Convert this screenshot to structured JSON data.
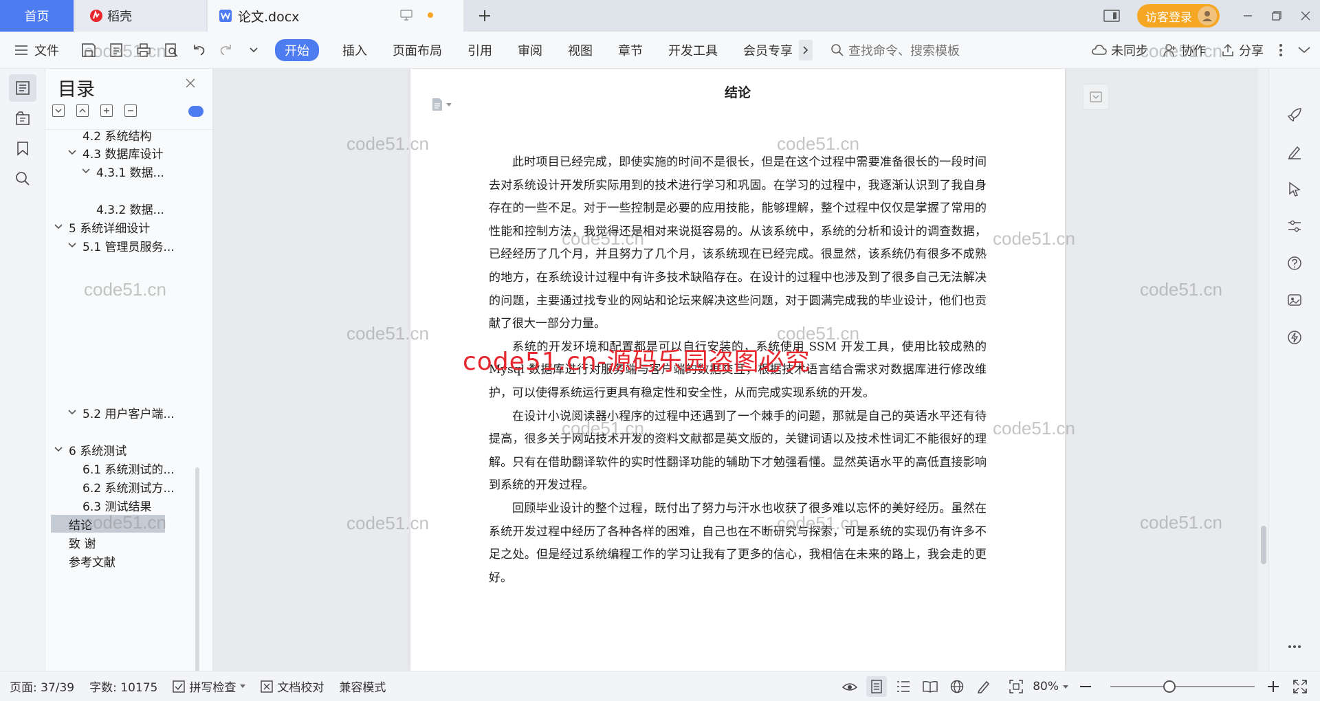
{
  "tabs": {
    "home": "首页",
    "daoke": "稻壳",
    "doc": "论文.docx"
  },
  "titlebar": {
    "login": "访客登录"
  },
  "menubar": {
    "file": "文件",
    "items": [
      "开始",
      "插入",
      "页面布局",
      "引用",
      "审阅",
      "视图",
      "章节",
      "开发工具",
      "会员专享"
    ],
    "active_index": 0,
    "search_placeholder": "查找命令、搜索模板",
    "sync": "未同步",
    "collab": "协作",
    "share": "分享"
  },
  "toc": {
    "title": "目录",
    "items": [
      {
        "label": "4.2  系统结构",
        "level": 2,
        "chevron": false
      },
      {
        "label": "4.3 数据库设计",
        "level": 2,
        "chevron": true
      },
      {
        "label": "4.3.1  数据...",
        "level": 3,
        "chevron": true
      },
      {
        "label": "4.3.2  数据...",
        "level": 3,
        "chevron": false
      },
      {
        "label": "5  系统详细设计",
        "level": 1,
        "chevron": true
      },
      {
        "label": "5.1 管理员服务...",
        "level": 2,
        "chevron": true
      },
      {
        "label": "5.2 用户客户端...",
        "level": 2,
        "chevron": true
      },
      {
        "label": "6  系统测试",
        "level": 1,
        "chevron": true
      },
      {
        "label": "6.1 系统测试的...",
        "level": 2,
        "chevron": false
      },
      {
        "label": "6.2 系统测试方...",
        "level": 2,
        "chevron": false
      },
      {
        "label": "6.3  测试结果",
        "level": 2,
        "chevron": false
      },
      {
        "label": "结论",
        "level": 1,
        "chevron": false,
        "selected": true
      },
      {
        "label": "致    谢",
        "level": 1,
        "chevron": false
      },
      {
        "label": "参考文献",
        "level": 1,
        "chevron": false
      }
    ]
  },
  "document": {
    "title": "结论",
    "paragraphs": [
      "此时项目已经完成，即使实施的时间不是很长，但是在这个过程中需要准备很长的一段时间去对系统设计开发所实际用到的技术进行学习和巩固。在学习的过程中，我逐渐认识到了我自身存在的一些不足。对于一些控制是必要的应用技能，能够理解，整个过程中仅仅是掌握了常用的性能和控制方法，我觉得还是相对来说挺容易的。从该系统中，系统的分析和设计的调查数据，已经经历了几个月，并且努力了几个月，该系统现在已经完成。很显然，该系统仍有很多不成熟的地方，在系统设计过程中有许多技术缺陷存在。在设计的过程中也涉及到了很多自己无法解决的问题，主要通过找专业的网站和论坛来解决这些问题，对于圆满完成我的毕业设计，他们也贡献了很大一部分力量。",
      "系统的开发环境和配置都是可以自行安装的，系统使用 SSM 开发工具，使用比较成熟的 Mysql 数据库进行对服务端与客户端的数据交互，根据技术语言结合需求对数据库进行修改维护，可以使得系统运行更具有稳定性和安全性，从而完成实现系统的开发。",
      "在设计小说阅读器小程序的过程中还遇到了一个棘手的问题，那就是自己的英语水平还有待提高，很多关于网站技术开发的资料文献都是英文版的，关键词语以及技术性词汇不能很好的理解。只有在借助翻译软件的实时性翻译功能的辅助下才勉强看懂。显然英语水平的高低直接影响到系统的开发过程。",
      "回顾毕业设计的整个过程，既付出了努力与汗水也收获了很多难以忘怀的美好经历。虽然在系统开发过程中经历了各种各样的困难，自己也在不断研究与探索，可是系统的实现仍有许多不足之处。但是经过系统编程工作的学习让我有了更多的信心，我相信在未来的路上，我会走的更好。"
    ]
  },
  "watermarks": {
    "small": "code51.cn",
    "big": "code51.cn-源码乐园盗图必究"
  },
  "statusbar": {
    "page": "页面: 37/39",
    "words": "字数: 10175",
    "spellcheck": "拼写检查",
    "proofread": "文档校对",
    "compat": "兼容模式",
    "zoom": "80%",
    "zoom_level": 0.4
  },
  "colors": {
    "accent": "#4d7cf0",
    "login": "#f5a623",
    "watermark_red": "#e8262e"
  }
}
